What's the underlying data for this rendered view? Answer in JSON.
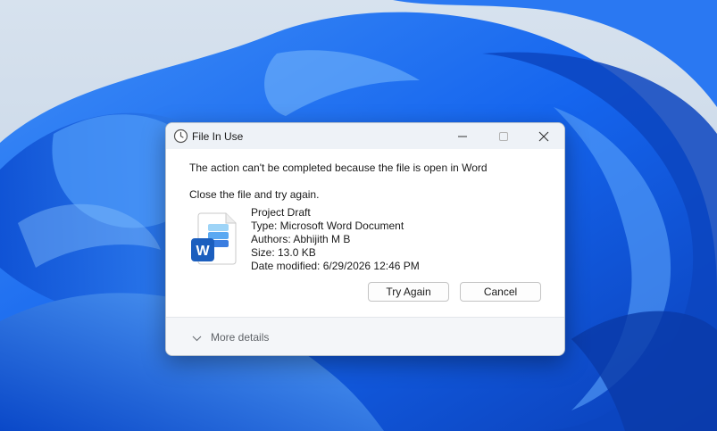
{
  "dialog": {
    "title": "File In Use",
    "message": "The action can't be completed because the file is open in Word",
    "instruction": "Close the file and try again.",
    "file": {
      "name": "Project Draft",
      "type": "Type: Microsoft Word Document",
      "authors": "Authors: Abhijith M B",
      "size": "Size: 13.0 KB",
      "modified": "Date modified: 6/29/2026 12:46 PM",
      "icon": "word-document-icon",
      "icon_letter": "W"
    },
    "buttons": {
      "try_again": "Try Again",
      "cancel": "Cancel"
    },
    "more_details": "More details"
  },
  "colors": {
    "word_blue": "#1b5ebe",
    "accent_teal": "#3ad0c8",
    "wallpaper_blue": "#1a6cf0"
  }
}
